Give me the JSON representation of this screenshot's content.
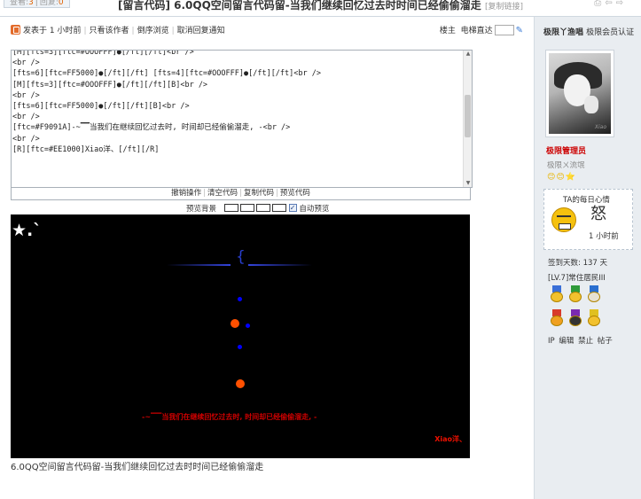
{
  "topbar": {
    "views_label": "查看:",
    "views_count": "3",
    "replies_label": "回复:",
    "replies_count": "0",
    "title": "[留言代码] 6.0QQ空间留言代码留-当我们继续回忆过去时时间已经偷偷溜走",
    "copy_link": "[复制链接]"
  },
  "author_line": {
    "posted": "发表于 1 小时前",
    "only_author": "只看该作者",
    "reverse": "倒序浏览",
    "cancel_notify": "取消回复通知",
    "floor": "楼主",
    "jump": "电梯直达"
  },
  "code_lines": [
    "[M][fts=3][ftc=#OOOFFF]●[/ft][/ft]<br />",
    "<br />",
    "[fts=6][ftc=FF5000]●[/ft][/ft] [fts=4][ftc=#OOOFFF]●[/ft][/ft]<br />",
    "[M][fts=3][ftc=#OOOFFF]●[/ft][/ft][B]<br />",
    "<br />",
    "[fts=6][ftc=FF5000]●[/ft][/ft][B]<br />",
    "<br />",
    "[ftc=#F9091A]-~▔▔当我们在继续回忆过去时, 时间却已经偷偷溜走, -<br />",
    "<br />",
    "[R][ftc=#EE1000]Xiao洋、[/ft][/R]"
  ],
  "code_buttons": [
    "撤销操作",
    "清空代码",
    "复制代码",
    "预览代码"
  ],
  "preview_bar": {
    "bg_label": "预览背景",
    "auto_label": "自动预览"
  },
  "preview": {
    "star_text": "★.`",
    "brace": "{",
    "sig_line": "-~▔▔当我们在继续回忆过去时, 时间却已经偷偷溜走, -",
    "sig_name": "Xiao洋、"
  },
  "post_title": "6.0QQ空间留言代码留-当我们继续回忆过去时时间已经偷偷溜走",
  "sidebar": {
    "username": "极限丫渔唱",
    "vip": "极限会员认证",
    "avatar_sig": "Xiao",
    "group": "极限管理员",
    "subtitle": "极限ㄨ流氓",
    "faces": "😊😊⭐",
    "mood_title": "TA的每日心情",
    "mood_word": "怒",
    "mood_time": "1 小时前",
    "signin": "签到天数: 137 天",
    "level": "[LV.7]常住居民III",
    "actions": [
      "IP",
      "编辑",
      "禁止",
      "帖子"
    ]
  },
  "colors": {
    "preview_bg": "#000000",
    "blue_dot": "#0000ff",
    "orange_dot": "#ff5000",
    "sig_red": "#f9091a",
    "name_red": "#ee1000"
  }
}
